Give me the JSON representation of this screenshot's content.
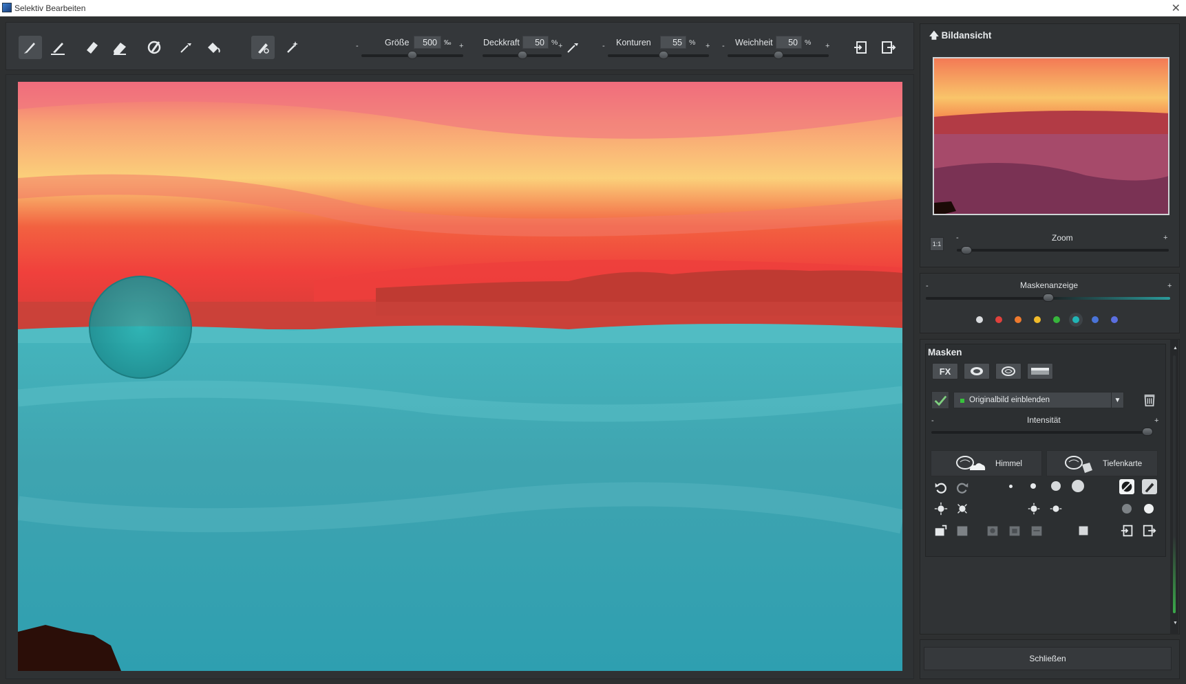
{
  "window": {
    "title": "Selektiv Bearbeiten",
    "close_glyph": "✕"
  },
  "toolbar": {
    "tools": [
      "brush-icon",
      "fine-brush-icon",
      "eraser-icon",
      "soft-eraser-icon",
      "lasso-brush-icon",
      "pipette-icon",
      "fill-bucket-icon",
      "smart-brush-icon",
      "magic-wand-icon"
    ],
    "params": [
      {
        "label": "Größe",
        "value": "500",
        "unit": "‰",
        "minus": "-",
        "plus": "+",
        "level": 0.5
      },
      {
        "label": "Deckkraft",
        "value": "50",
        "unit": "%",
        "minus": "",
        "plus": "+",
        "level": 0.5
      },
      {
        "label": "Konturen",
        "value": "55",
        "unit": "%",
        "minus": "-",
        "plus": "+",
        "level": 0.55
      },
      {
        "label": "Weichheit",
        "value": "50",
        "unit": "%",
        "minus": "-",
        "plus": "+",
        "level": 0.5
      }
    ]
  },
  "bildansicht": {
    "title": "Bildansicht",
    "one_to_one": "1:1",
    "zoom_label": "Zoom",
    "zoom_minus": "-",
    "zoom_plus": "+",
    "zoom_level": 0.02
  },
  "maskenanzeige": {
    "label": "Maskenanzeige",
    "minus": "-",
    "plus": "+",
    "level": 0.5,
    "colors": [
      "#d9dcdf",
      "#e0413c",
      "#ee7a2e",
      "#f1bb2a",
      "#37b53c",
      "#21b5b5",
      "#4a74d8",
      "#5b6fe0"
    ],
    "selected_color_index": 5
  },
  "masken": {
    "title": "Masken",
    "tabs": [
      "FX",
      "ellipse-mask-icon",
      "brain-mask-icon",
      "gradient-mask-icon"
    ],
    "dropdown_value": "Originalbild einblenden",
    "intensity_label": "Intensität",
    "intensity_minus": "-",
    "intensity_plus": "+",
    "intensity_level": 0.98,
    "ai_buttons": [
      {
        "label": "Himmel",
        "icon": "brain-sky-icon"
      },
      {
        "label": "Tiefenkarte",
        "icon": "brain-depth-icon"
      }
    ]
  },
  "footer": {
    "close_label": "Schließen"
  }
}
